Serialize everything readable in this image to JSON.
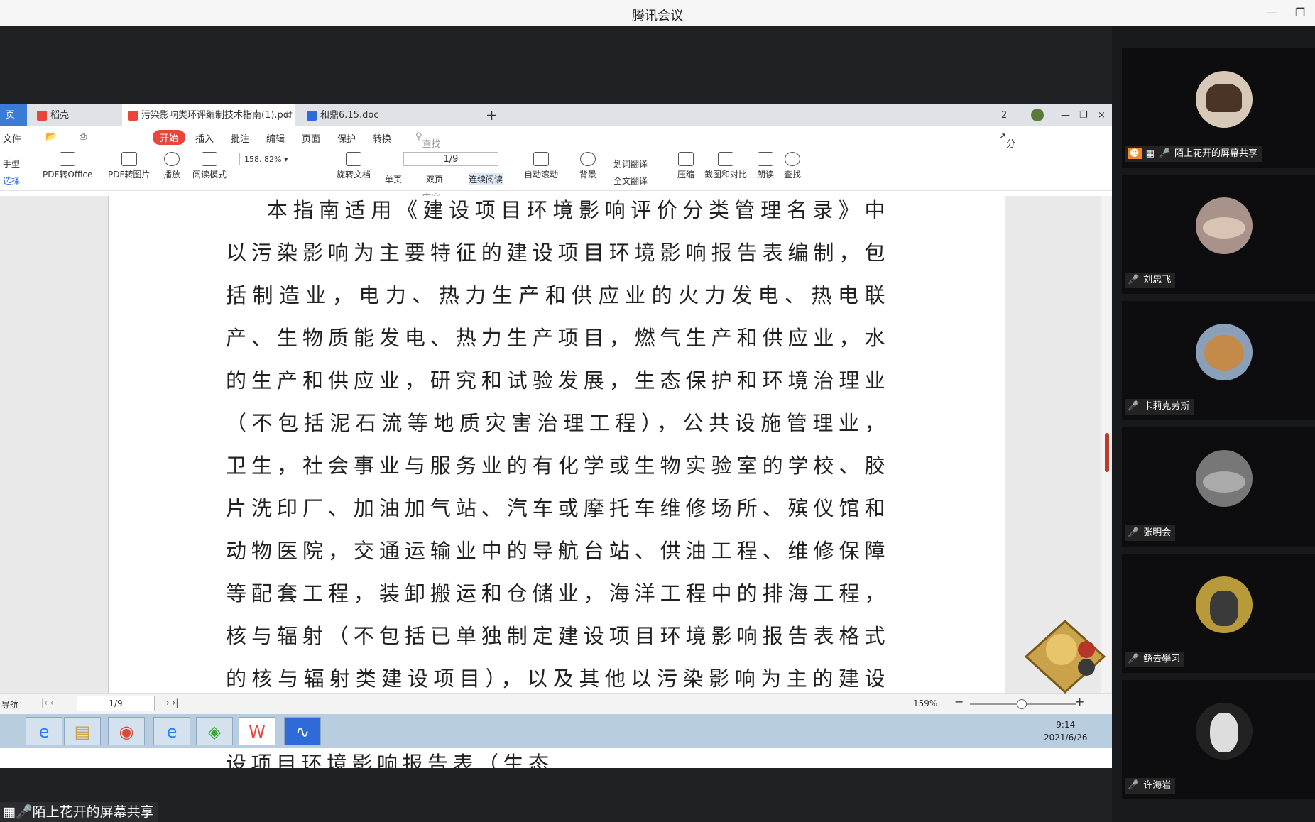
{
  "window": {
    "title": "腾讯会议"
  },
  "wps": {
    "tabs": [
      {
        "label": "页"
      },
      {
        "label": "稻壳"
      },
      {
        "label": "污染影响类环评编制技术指南(1).pdf"
      },
      {
        "label": "和鼎6.15.doc"
      }
    ],
    "tab_count_badge": "2",
    "menu": {
      "file": "文件",
      "start": "开始",
      "items": [
        "插入",
        "批注",
        "编辑",
        "页面",
        "保护",
        "转换"
      ],
      "search_placeholder": "查找功能、文档内容",
      "share": "分享"
    },
    "toolbar": {
      "hand": "手型",
      "select": "选择",
      "pdf_to_office": "PDF转Office",
      "pdf_to_image": "PDF转图片",
      "play": "播放",
      "read_mode": "阅读模式",
      "zoom": "158. 82%",
      "rotate": "旋转文档",
      "page": "1/9",
      "single": "单页",
      "double": "双页",
      "continuous": "连续阅读",
      "autoscroll": "自动滚动",
      "background": "背景",
      "word_translate": "划词翻译",
      "full_translate": "全文翻译",
      "compress": "压缩",
      "screenshot_compare": "截图和对比",
      "read_aloud": "朗读",
      "find": "查找"
    },
    "document": {
      "paragraph": "本指南适用《建设项目环境影响评价分类管理名录》中以污染影响为主要特征的建设项目环境影响报告表编制，包括制造业，电力、热力生产和供应业的火力发电、热电联产、生物质能发电、热力生产项目，燃气生产和供应业，水的生产和供应业，研究和试验发展，生态保护和环境治理业（不包括泥石流等地质灾害治理工程），公共设施管理业，卫生，社会事业与服务业的有化学或生物实验室的学校、胶片洗印厂、加油加气站、汽车或摩托车维修场所、殡仪馆和动物医院，交通运输业中的导航台站、供油工程、维修保障等配套工程，装卸搬运和仓储业，海洋工程中的排海工程，核与辐射（不包括已单独制定建设项目环境影响报告表格式的核与辐射类建设项目），以及其他以污染影响为主的建设项目。其他同时涉及污染和生态影响的建设项目，填写《建设项目环境影响报告表（生态"
    },
    "status": {
      "nav": "导航",
      "page": "1/9",
      "zoom": "159%"
    }
  },
  "taskbar": {
    "time": "9:14",
    "date": "2021/6/26"
  },
  "share_label": "陌上花开的屏幕共享",
  "participants": [
    {
      "name": "陌上花开的屏幕共享",
      "sharing": true
    },
    {
      "name": "刘忠飞",
      "sharing": false
    },
    {
      "name": "卡莉克劳斯",
      "sharing": false
    },
    {
      "name": "张明会",
      "sharing": false
    },
    {
      "name": "鲧去學习",
      "sharing": false
    },
    {
      "name": "许海岩",
      "sharing": false
    }
  ],
  "colors": {
    "accent_red": "#e8453c",
    "panel_bg": "#18191c",
    "taskbar": "#b9cde0"
  }
}
